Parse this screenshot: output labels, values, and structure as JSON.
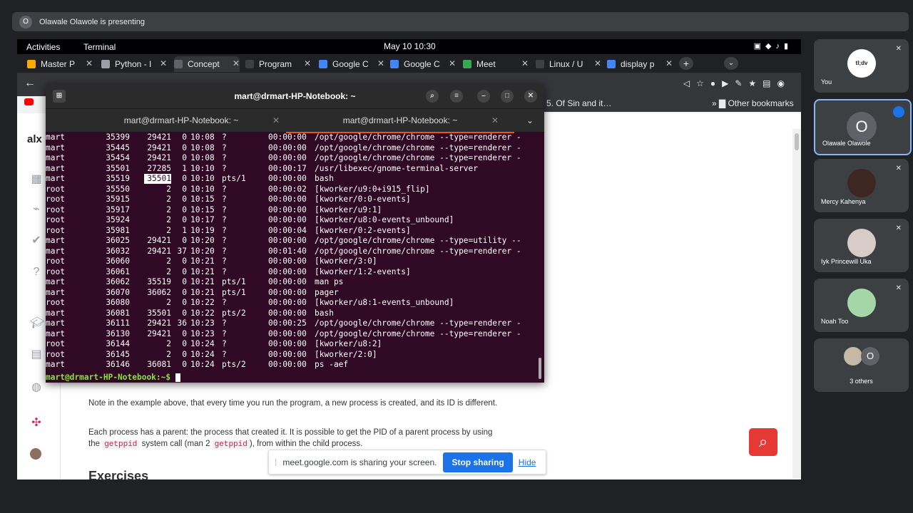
{
  "presenting_banner": {
    "avatar_letter": "O",
    "text": "Olawale Olawole is presenting"
  },
  "topbar": {
    "activities": "Activities",
    "app": "Terminal",
    "clock": "May 10  10:30"
  },
  "browser_tabs": [
    {
      "label": "Master P",
      "color": "#f9ab00"
    },
    {
      "label": "Python - I",
      "color": "#9aa0a6"
    },
    {
      "label": "Concept",
      "color": "#5f6368"
    },
    {
      "label": "Program",
      "color": "#3c4043"
    },
    {
      "label": "Google C",
      "color": "#4285f4"
    },
    {
      "label": "Google C",
      "color": "#4285f4"
    },
    {
      "label": "Meet",
      "color": "#34a853"
    },
    {
      "label": "Linux / U",
      "color": "#3c4043"
    },
    {
      "label": "display p",
      "color": "#4285f4"
    }
  ],
  "bookmarks": {
    "item1": "5. Of Sin and it…",
    "other": "Other bookmarks"
  },
  "terminal": {
    "window_title": "mart@drmart-HP-Notebook: ~",
    "tab1": "mart@drmart-HP-Notebook: ~",
    "tab2": "mart@drmart-HP-Notebook: ~",
    "rows": [
      {
        "user": "mart",
        "pid": "35399",
        "ppid": "29421",
        "c": "0",
        "stime": "10:08",
        "tty": "?",
        "time": "00:00:00",
        "cmd": "/opt/google/chrome/chrome --type=renderer -"
      },
      {
        "user": "mart",
        "pid": "35445",
        "ppid": "29421",
        "c": "0",
        "stime": "10:08",
        "tty": "?",
        "time": "00:00:00",
        "cmd": "/opt/google/chrome/chrome --type=renderer -"
      },
      {
        "user": "mart",
        "pid": "35454",
        "ppid": "29421",
        "c": "0",
        "stime": "10:08",
        "tty": "?",
        "time": "00:00:00",
        "cmd": "/opt/google/chrome/chrome --type=renderer -"
      },
      {
        "user": "mart",
        "pid": "35501",
        "ppid": "27285",
        "c": "1",
        "stime": "10:10",
        "tty": "?",
        "time": "00:00:17",
        "cmd": "/usr/libexec/gnome-terminal-server"
      },
      {
        "user": "mart",
        "pid": "35519",
        "ppid": "35501",
        "c": "0",
        "stime": "10:10",
        "tty": "pts/1",
        "time": "00:00:00",
        "cmd": "bash"
      },
      {
        "user": "root",
        "pid": "35550",
        "ppid": "2",
        "c": "0",
        "stime": "10:10",
        "tty": "?",
        "time": "00:00:02",
        "cmd": "[kworker/u9:0+i915_flip]"
      },
      {
        "user": "root",
        "pid": "35915",
        "ppid": "2",
        "c": "0",
        "stime": "10:15",
        "tty": "?",
        "time": "00:00:00",
        "cmd": "[kworker/0:0-events]"
      },
      {
        "user": "root",
        "pid": "35917",
        "ppid": "2",
        "c": "0",
        "stime": "10:15",
        "tty": "?",
        "time": "00:00:00",
        "cmd": "[kworker/u9:1]"
      },
      {
        "user": "root",
        "pid": "35924",
        "ppid": "2",
        "c": "0",
        "stime": "10:17",
        "tty": "?",
        "time": "00:00:00",
        "cmd": "[kworker/u8:0-events_unbound]"
      },
      {
        "user": "root",
        "pid": "35981",
        "ppid": "2",
        "c": "1",
        "stime": "10:19",
        "tty": "?",
        "time": "00:00:04",
        "cmd": "[kworker/0:2-events]"
      },
      {
        "user": "mart",
        "pid": "36025",
        "ppid": "29421",
        "c": "0",
        "stime": "10:20",
        "tty": "?",
        "time": "00:00:00",
        "cmd": "/opt/google/chrome/chrome --type=utility --"
      },
      {
        "user": "mart",
        "pid": "36032",
        "ppid": "29421",
        "c": "37",
        "stime": "10:20",
        "tty": "?",
        "time": "00:01:40",
        "cmd": "/opt/google/chrome/chrome --type=renderer -"
      },
      {
        "user": "root",
        "pid": "36060",
        "ppid": "2",
        "c": "0",
        "stime": "10:21",
        "tty": "?",
        "time": "00:00:00",
        "cmd": "[kworker/3:0]"
      },
      {
        "user": "root",
        "pid": "36061",
        "ppid": "2",
        "c": "0",
        "stime": "10:21",
        "tty": "?",
        "time": "00:00:00",
        "cmd": "[kworker/1:2-events]"
      },
      {
        "user": "mart",
        "pid": "36062",
        "ppid": "35519",
        "c": "0",
        "stime": "10:21",
        "tty": "pts/1",
        "time": "00:00:00",
        "cmd": "man ps"
      },
      {
        "user": "mart",
        "pid": "36070",
        "ppid": "36062",
        "c": "0",
        "stime": "10:21",
        "tty": "pts/1",
        "time": "00:00:00",
        "cmd": "pager"
      },
      {
        "user": "root",
        "pid": "36080",
        "ppid": "2",
        "c": "0",
        "stime": "10:22",
        "tty": "?",
        "time": "00:00:00",
        "cmd": "[kworker/u8:1-events_unbound]"
      },
      {
        "user": "mart",
        "pid": "36081",
        "ppid": "35501",
        "c": "0",
        "stime": "10:22",
        "tty": "pts/2",
        "time": "00:00:00",
        "cmd": "bash"
      },
      {
        "user": "mart",
        "pid": "36111",
        "ppid": "29421",
        "c": "36",
        "stime": "10:23",
        "tty": "?",
        "time": "00:00:25",
        "cmd": "/opt/google/chrome/chrome --type=renderer -"
      },
      {
        "user": "mart",
        "pid": "36130",
        "ppid": "29421",
        "c": "0",
        "stime": "10:23",
        "tty": "?",
        "time": "00:00:00",
        "cmd": "/opt/google/chrome/chrome --type=renderer -"
      },
      {
        "user": "root",
        "pid": "36144",
        "ppid": "2",
        "c": "0",
        "stime": "10:24",
        "tty": "?",
        "time": "00:00:00",
        "cmd": "[kworker/u8:2]"
      },
      {
        "user": "root",
        "pid": "36145",
        "ppid": "2",
        "c": "0",
        "stime": "10:24",
        "tty": "?",
        "time": "00:00:00",
        "cmd": "[kworker/2:0]"
      },
      {
        "user": "mart",
        "pid": "36146",
        "ppid": "36081",
        "c": "0",
        "stime": "10:24",
        "tty": "pts/2",
        "time": "00:00:00",
        "cmd": "ps -aef"
      }
    ],
    "prompt": "mart@drmart-HP-Notebook:~$ "
  },
  "webpage": {
    "logo": "alx",
    "para1": "Note in the example above, that every time you run the program, a new process is created, and its ID is different.",
    "para2_a": "Each process has a parent: the process that created it. It is possible to get the PID of a parent process by using the ",
    "code1": "getppid",
    "para2_b": " system call (man 2 ",
    "code2": "getppid",
    "para2_c": "), from within the child process.",
    "heading": "Exercises"
  },
  "share_bar": {
    "text": "meet.google.com is sharing your screen.",
    "stop": "Stop sharing",
    "hide": "Hide"
  },
  "participants": [
    {
      "name": "You",
      "avatar_text": "tl;dv"
    },
    {
      "name": "Olawale Olawole",
      "avatar_text": "O"
    },
    {
      "name": "Mercy Kahenya"
    },
    {
      "name": "Iyk Princewill Uka"
    },
    {
      "name": "Noah Too"
    },
    {
      "name": "3 others",
      "avatar_text": "O"
    }
  ]
}
